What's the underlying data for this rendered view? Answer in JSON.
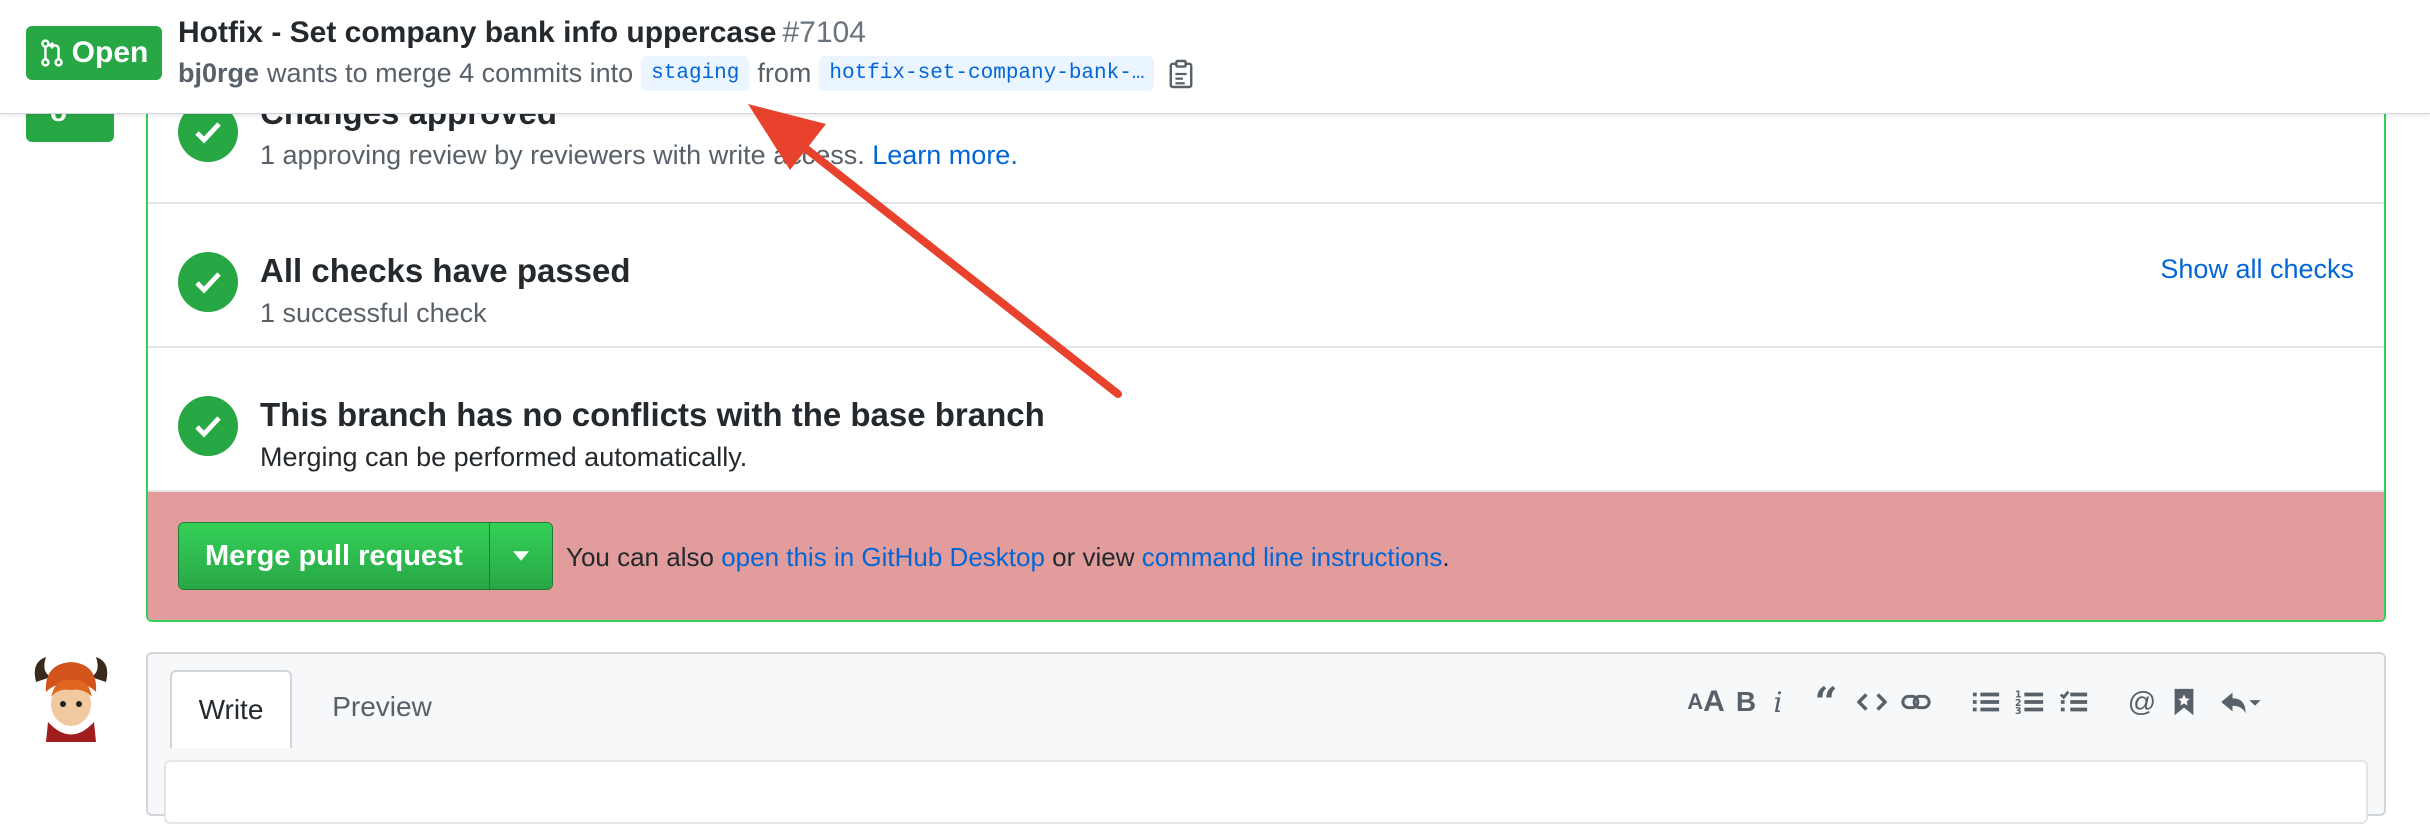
{
  "header": {
    "state_label": "Open",
    "title": "Hotfix - Set company bank info uppercase",
    "number": "#7104",
    "author": "bj0rge",
    "merge_text": "wants to merge 4 commits into",
    "base_branch": "staging",
    "from_text": "from",
    "head_branch": "hotfix-set-company-bank-…"
  },
  "merge_box": {
    "review": {
      "title": "Changes approved",
      "desc": "1 approving review by reviewers with write access.",
      "learn_more": "Learn more."
    },
    "checks": {
      "title": "All checks have passed",
      "desc": "1 successful check",
      "show_all": "Show all checks"
    },
    "conflicts": {
      "title": "This branch has no conflicts with the base branch",
      "desc": "Merging can be performed automatically."
    },
    "action": {
      "merge_label": "Merge pull request",
      "alt_prefix": "You can also",
      "desktop_link": "open this in GitHub Desktop",
      "alt_middle": "or view",
      "cli_link": "command line instructions",
      "alt_suffix": "."
    }
  },
  "composer": {
    "tab_write": "Write",
    "tab_preview": "Preview",
    "toolbar_icons": [
      "header-icon",
      "bold-icon",
      "italic-icon",
      "quote-icon",
      "code-icon",
      "link-icon",
      "unordered-list-icon",
      "ordered-list-icon",
      "task-list-icon",
      "mention-icon",
      "saved-reply-icon",
      "reply-icon"
    ]
  },
  "colors": {
    "accent_green": "#28a745",
    "link_blue": "#0366d6",
    "merge_highlight": "#e29c9c",
    "annotation_red": "#e8412c"
  }
}
